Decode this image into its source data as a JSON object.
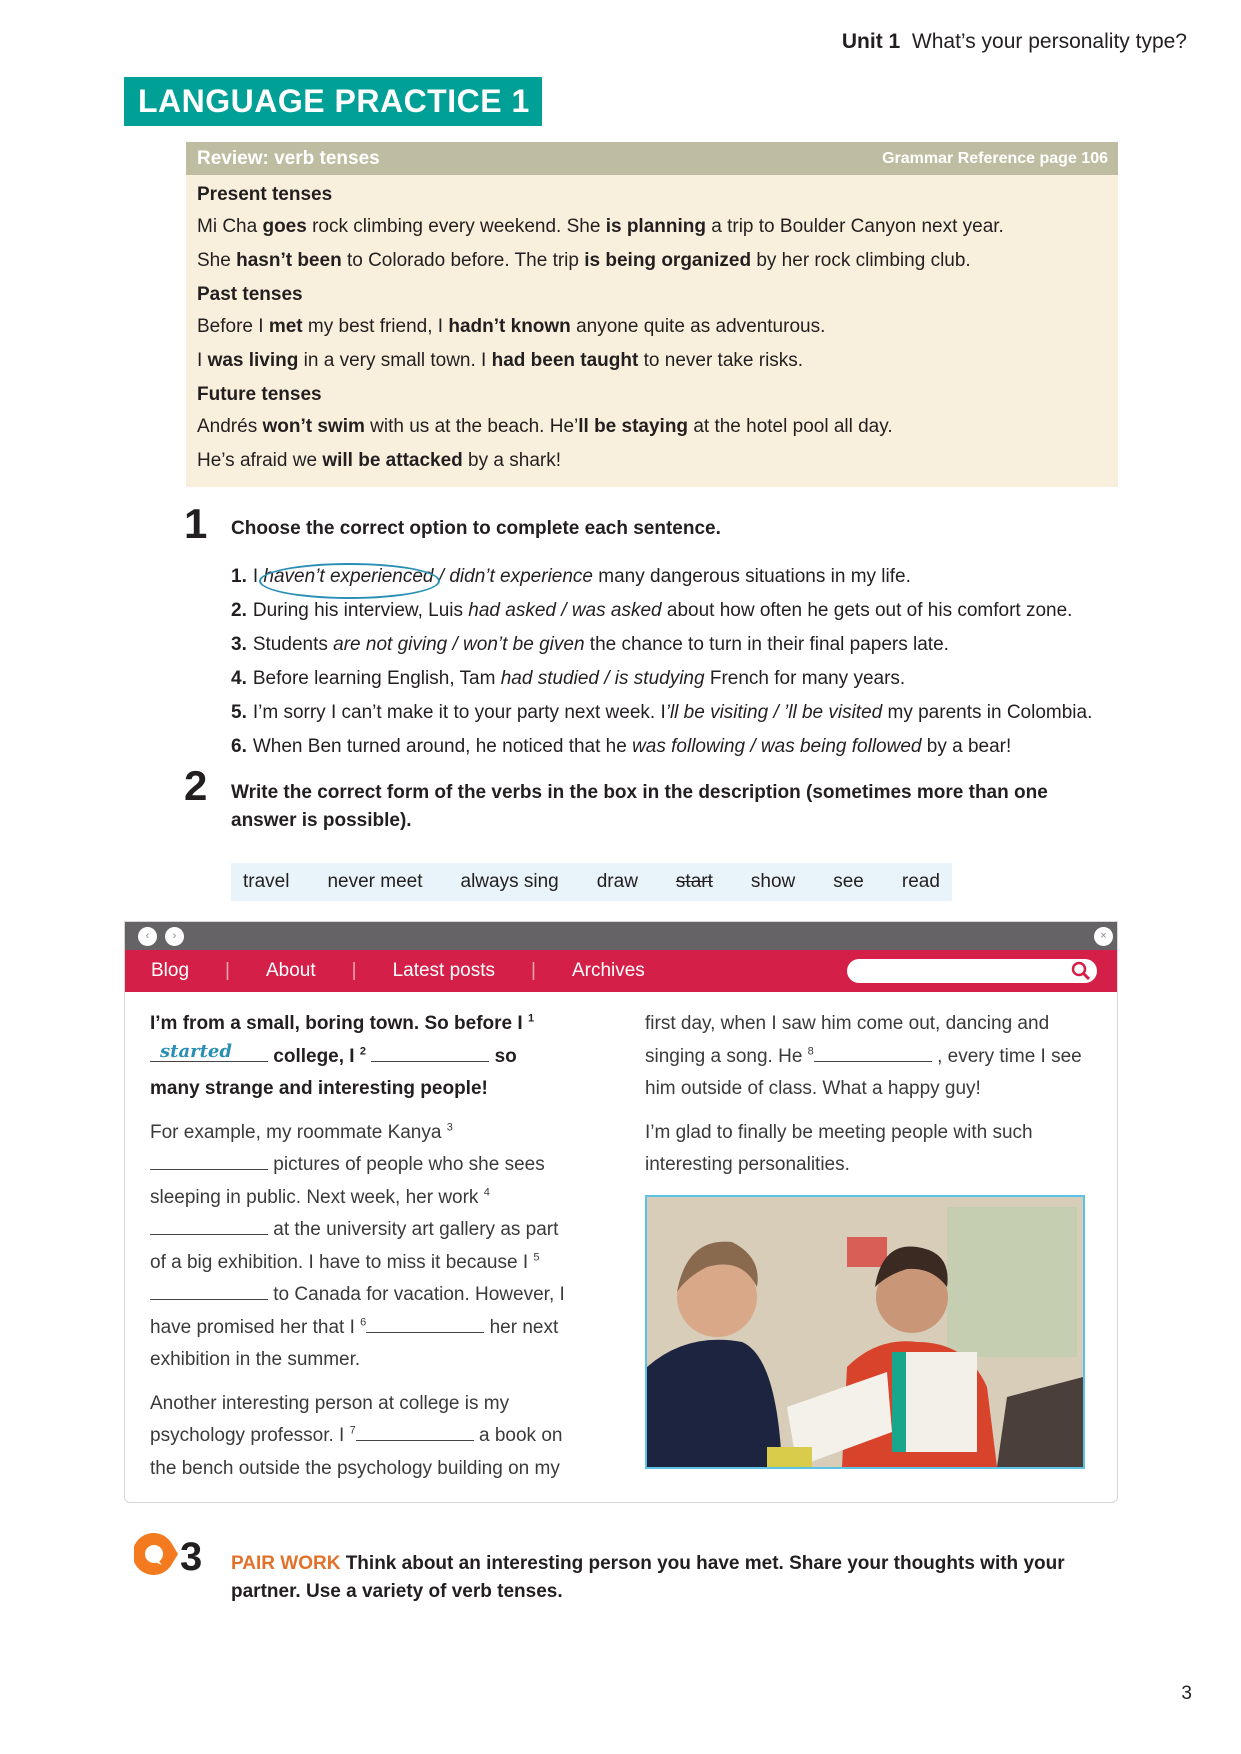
{
  "running_head": {
    "unit": "Unit 1",
    "title": "What’s your personality type?"
  },
  "banner": "LANGUAGE PRACTICE 1",
  "review": {
    "title": "Review: verb tenses",
    "reference": "Grammar Reference page 106",
    "sections": [
      {
        "heading": "Present tenses",
        "lines": [
          [
            {
              "t": "Mi Cha "
            },
            {
              "t": "goes",
              "b": true
            },
            {
              "t": " rock climbing every weekend. She "
            },
            {
              "t": "is planning",
              "b": true
            },
            {
              "t": " a trip to Boulder Canyon next year."
            }
          ],
          [
            {
              "t": "She "
            },
            {
              "t": "hasn’t been",
              "b": true
            },
            {
              "t": " to Colorado before. The trip "
            },
            {
              "t": "is being organized",
              "b": true
            },
            {
              "t": " by her rock climbing club."
            }
          ]
        ]
      },
      {
        "heading": "Past tenses",
        "lines": [
          [
            {
              "t": "Before I "
            },
            {
              "t": "met",
              "b": true
            },
            {
              "t": " my best friend, I "
            },
            {
              "t": "hadn’t known",
              "b": true
            },
            {
              "t": " anyone quite as adventurous."
            }
          ],
          [
            {
              "t": "I "
            },
            {
              "t": "was living",
              "b": true
            },
            {
              "t": " in a very small town. I "
            },
            {
              "t": "had been taught",
              "b": true
            },
            {
              "t": " to never take risks."
            }
          ]
        ]
      },
      {
        "heading": "Future tenses",
        "lines": [
          [
            {
              "t": "Andrés "
            },
            {
              "t": "won’t swim",
              "b": true
            },
            {
              "t": " with us at the beach. He’"
            },
            {
              "t": "ll be staying",
              "b": true
            },
            {
              "t": " at the hotel pool all day."
            }
          ],
          [
            {
              "t": "He’s afraid we "
            },
            {
              "t": "will be attacked",
              "b": true
            },
            {
              "t": " by a shark!"
            }
          ]
        ]
      }
    ]
  },
  "exercise1": {
    "number": "1",
    "instruction": "Choose the correct option to complete each sentence.",
    "items": [
      {
        "n": "1.",
        "parts": [
          {
            "t": "I "
          },
          {
            "t": "haven’t experienced",
            "i": true,
            "circled": true
          },
          {
            "t": " / didn’t experience",
            "i": true
          },
          {
            "t": " many dangerous situations in my life."
          }
        ]
      },
      {
        "n": "2.",
        "parts": [
          {
            "t": "During his interview, Luis "
          },
          {
            "t": "had asked / was asked",
            "i": true
          },
          {
            "t": " about how often he gets out of his comfort zone."
          }
        ]
      },
      {
        "n": "3.",
        "parts": [
          {
            "t": "Students "
          },
          {
            "t": "are not giving / won’t be given",
            "i": true
          },
          {
            "t": " the chance to turn in their final papers late."
          }
        ]
      },
      {
        "n": "4.",
        "parts": [
          {
            "t": "Before learning English, Tam "
          },
          {
            "t": "had studied / is studying",
            "i": true
          },
          {
            "t": " French for many years."
          }
        ]
      },
      {
        "n": "5.",
        "parts": [
          {
            "t": "I’m sorry I can’t make it to your party next week. I"
          },
          {
            "t": "’ll be visiting / ’ll be visited",
            "i": true
          },
          {
            "t": " my parents in Colombia."
          }
        ]
      },
      {
        "n": "6.",
        "parts": [
          {
            "t": "When Ben turned around, he noticed that he "
          },
          {
            "t": "was following / was being followed",
            "i": true
          },
          {
            "t": " by a bear!"
          }
        ]
      }
    ]
  },
  "exercise2": {
    "number": "2",
    "instruction": "Write the correct form of the verbs in the box in the description (sometimes more than one answer is possible).",
    "words": [
      {
        "w": "travel"
      },
      {
        "w": "never meet"
      },
      {
        "w": "always sing"
      },
      {
        "w": "draw"
      },
      {
        "w": "start",
        "struck": true
      },
      {
        "w": "show"
      },
      {
        "w": "see"
      },
      {
        "w": "read"
      }
    ]
  },
  "blog": {
    "nav": [
      "Blog",
      "About",
      "Latest posts",
      "Archives"
    ],
    "nav_separator": "|",
    "search_placeholder": "",
    "back_icon": "‹",
    "forward_icon": "›",
    "close_icon": "×",
    "colors": {
      "bar": "#656366",
      "nav": "#d41f48",
      "answer": "#2a8fb5"
    },
    "intro": {
      "a": "I’m from a small, boring town. So before I",
      "s1": "1",
      "answer1": "started",
      "b": "college, I",
      "s2": "2",
      "c": "so many strange and interesting people!"
    },
    "p1": {
      "a": "For example, my roommate Kanya",
      "s3": "3",
      "b": "pictures of people who she sees sleeping in public. Next week, her work",
      "s4": "4",
      "c": "at the university art gallery as part of a big exhibition. I have to miss it because I",
      "s5": "5",
      "d": "to Canada for vacation. However, I have promised her that I",
      "s6": "6",
      "e": "her next exhibition in the summer."
    },
    "p2": {
      "a": "Another interesting person at college is my psychology professor. I",
      "s7": "7",
      "b": "a book on the bench outside the psychology building on my"
    },
    "p3": {
      "a": "first day, when I saw him come out, dancing and singing a song. He",
      "s8": "8",
      "b": ", every time I see him outside of class. What a happy guy!"
    },
    "p4": "I’m glad to finally be meeting people with such interesting personalities.",
    "photo_alt": "Two women smiling at a table with books"
  },
  "exercise3": {
    "number": "3",
    "tag": "PAIR WORK",
    "instruction": "Think about an interesting person you have met. Share your thoughts with your partner. Use a variety of verb tenses.",
    "accent": "#f47a20"
  },
  "page_number": "3"
}
